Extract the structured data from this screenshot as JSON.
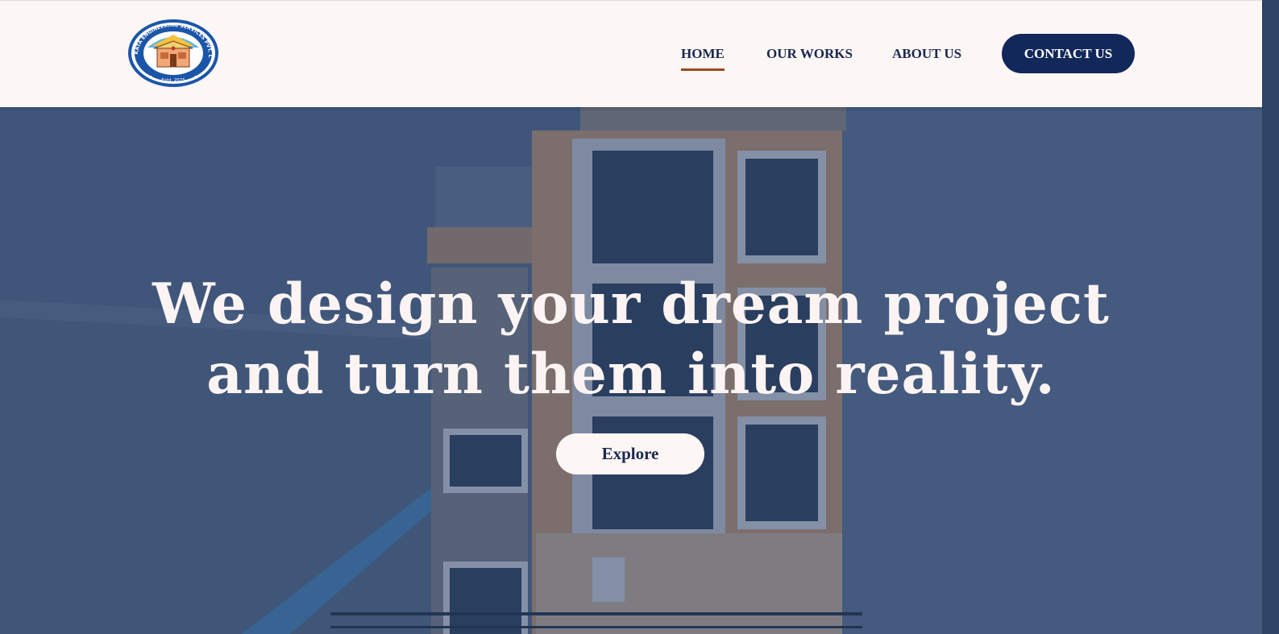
{
  "brand": {
    "logo_ring_text": "SANKATA ENGINEERING SERVICES PVT. LTD.",
    "logo_estd": "Estd. 2075"
  },
  "nav": {
    "items": [
      {
        "label": "HOME",
        "active": true
      },
      {
        "label": "OUR WORKS",
        "active": false
      },
      {
        "label": "ABOUT US",
        "active": false
      }
    ],
    "contact_label": "CONTACT US"
  },
  "hero": {
    "title_line1": "We design your dream project",
    "title_line2": "and turn them into reality.",
    "cta_label": "Explore"
  },
  "colors": {
    "header_bg": "#fcf6f5",
    "navy": "#12275a",
    "nav_text": "#1a2750",
    "active_underline": "#9a4a1f",
    "hero_overlay": "#28416e"
  }
}
